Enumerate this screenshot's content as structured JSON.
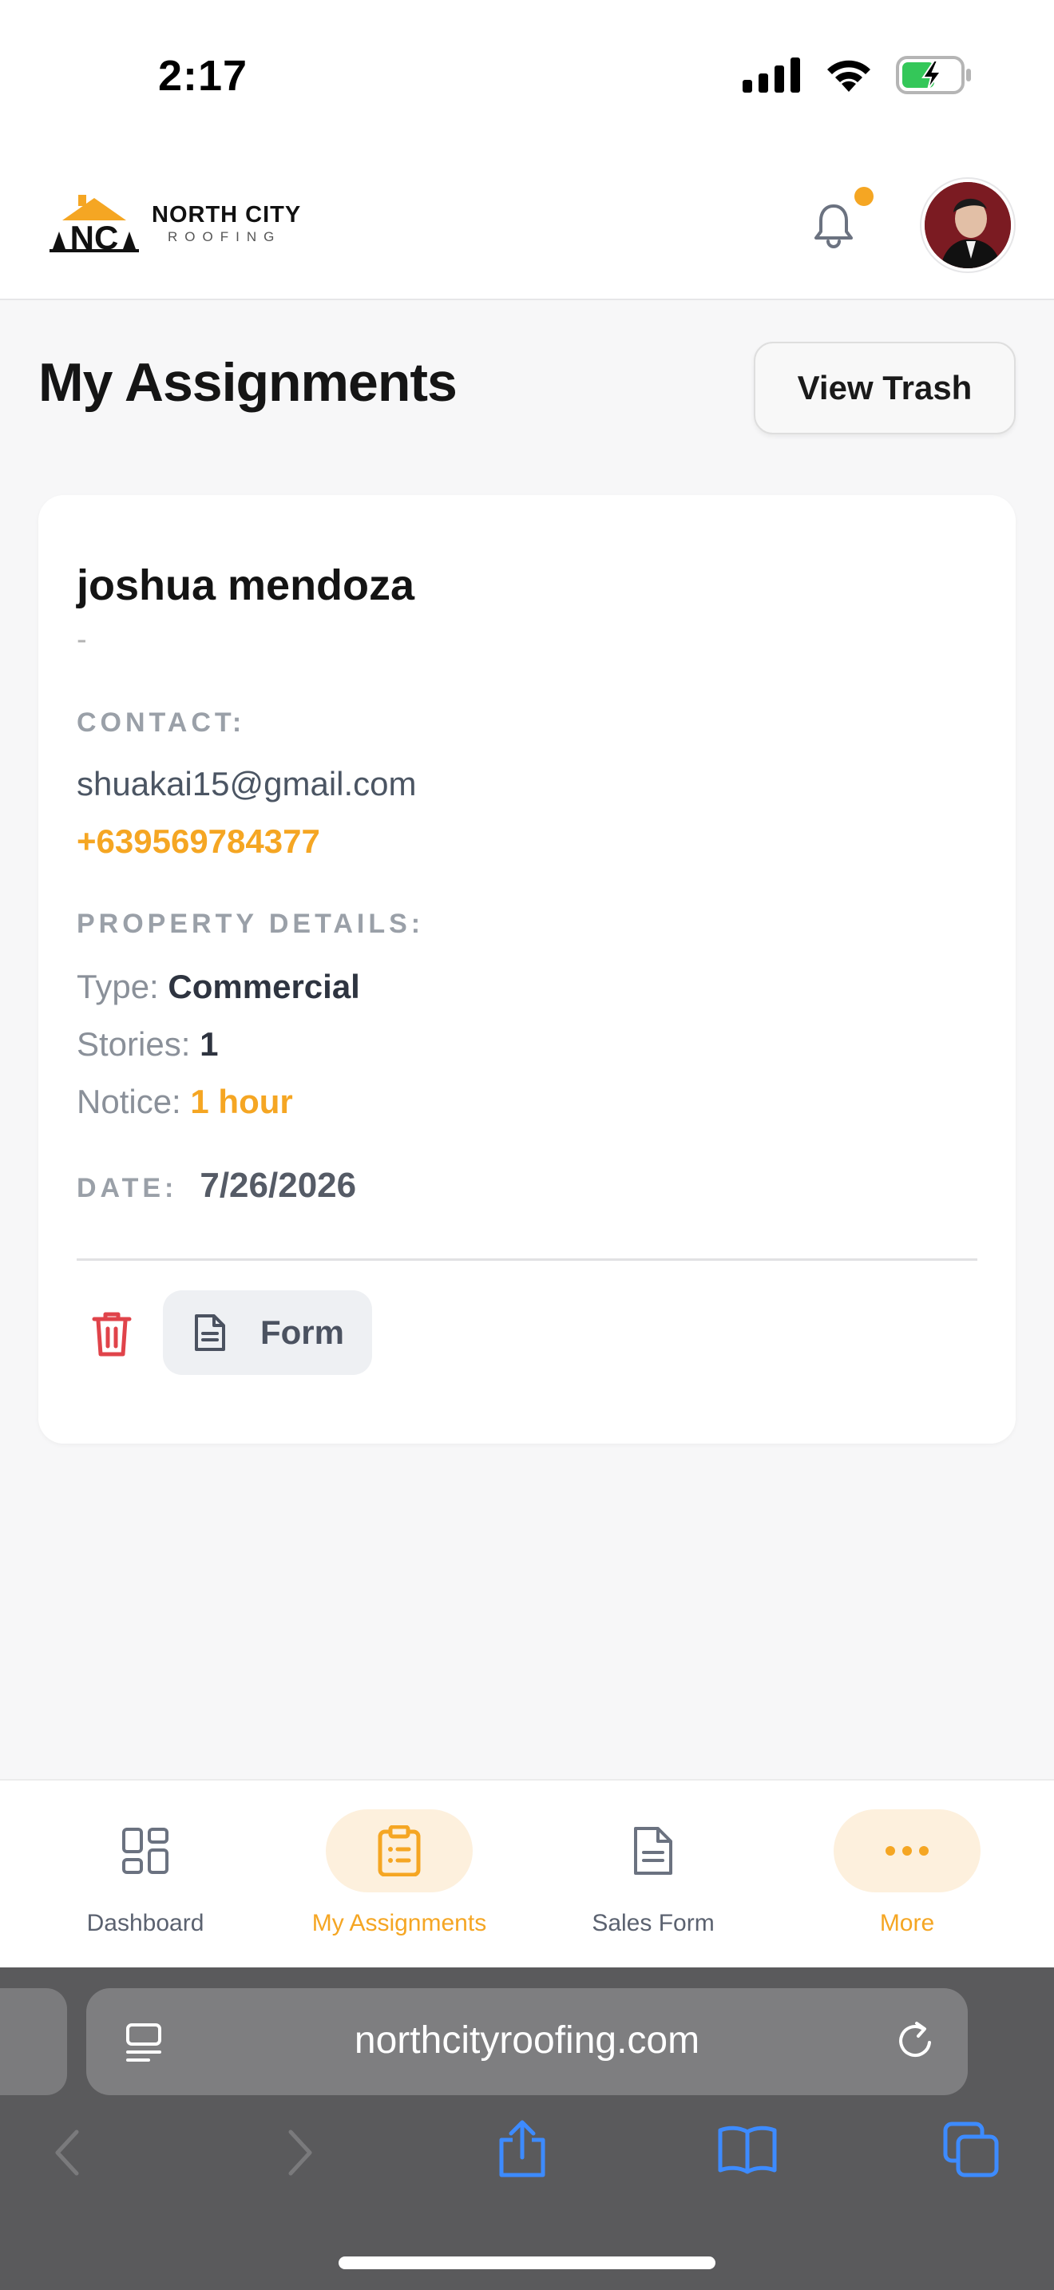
{
  "status": {
    "time": "2:17"
  },
  "header": {
    "logo_name": "NORTH CITY",
    "logo_sub": "ROOFING",
    "logo_mark": "NC"
  },
  "page": {
    "title": "My Assignments",
    "trash_button": "View Trash"
  },
  "assignment": {
    "name": "joshua mendoza",
    "subtitle": "-",
    "contact_label": "CONTACT:",
    "email": "shuakai15@gmail.com",
    "phone": "+639569784377",
    "property_label": "PROPERTY DETAILS:",
    "type_label": "Type:",
    "type_value": "Commercial",
    "stories_label": "Stories:",
    "stories_value": "1",
    "notice_label": "Notice:",
    "notice_value": "1 hour",
    "date_label": "DATE:",
    "date_value": "7/26/2026",
    "form_button": "Form"
  },
  "nav": {
    "items": [
      {
        "label": "Dashboard",
        "icon": "grid-icon",
        "active": false
      },
      {
        "label": "My Assignments",
        "icon": "clipboard-icon",
        "active": true
      },
      {
        "label": "Sales Form",
        "icon": "document-icon",
        "active": false
      },
      {
        "label": "More",
        "icon": "more-icon",
        "active": true
      }
    ]
  },
  "browser": {
    "url": "northcityroofing.com"
  },
  "colors": {
    "accent": "#f5a623",
    "danger": "#e0434a",
    "safari_blue": "#3d8bff"
  }
}
